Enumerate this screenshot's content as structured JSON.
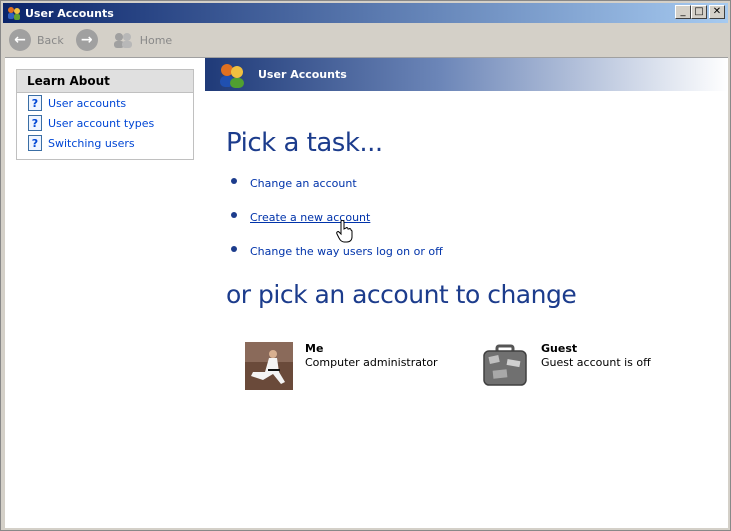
{
  "window": {
    "title": "User Accounts",
    "controls": {
      "minimize": "_",
      "maximize": "□",
      "close": "✕"
    }
  },
  "toolbar": {
    "back_label": "Back",
    "forward_label": "",
    "home_label": "Home"
  },
  "sidebar": {
    "header": "Learn About",
    "items": [
      {
        "label": "User accounts",
        "icon": "help-icon"
      },
      {
        "label": "User account types",
        "icon": "help-icon"
      },
      {
        "label": "Switching users",
        "icon": "help-icon"
      }
    ]
  },
  "banner": {
    "title": "User Accounts",
    "icon": "user-accounts-icon"
  },
  "main": {
    "heading": "Pick a task...",
    "tasks": [
      {
        "label": "Change an account"
      },
      {
        "label": "Create a new account"
      },
      {
        "label": "Change the way users log on or off"
      }
    ],
    "subheading": "or pick an account to change",
    "accounts": [
      {
        "name": "Me",
        "type": "Computer administrator",
        "picture": "karate-picture"
      },
      {
        "name": "Guest",
        "type": "Guest account is off",
        "picture": "suitcase-picture"
      }
    ]
  },
  "colors": {
    "titlebar_start": "#0a246a",
    "heading": "#1c3c8c",
    "link": "#0033aa"
  }
}
